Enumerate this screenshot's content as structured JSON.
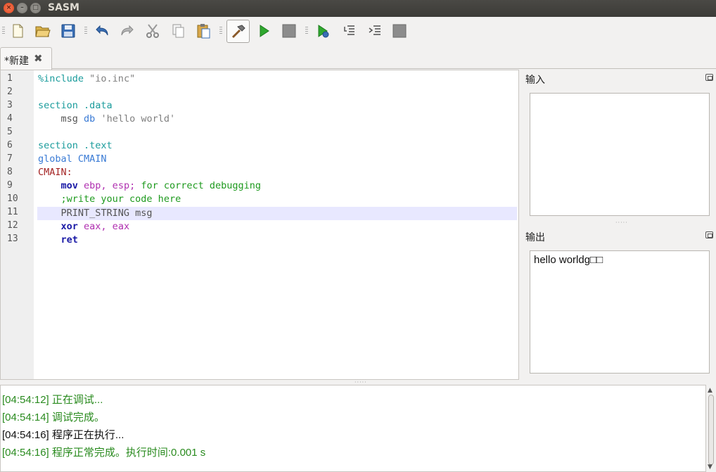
{
  "window": {
    "title": "SASM",
    "close_glyph": "×",
    "min_glyph": "–",
    "max_glyph": "□"
  },
  "toolbar": {
    "icons": [
      "new-file-icon",
      "open-folder-icon",
      "save-icon",
      "undo-icon",
      "redo-icon",
      "cut-icon",
      "copy-icon",
      "paste-icon",
      "build-hammer-icon",
      "run-icon",
      "stop-icon",
      "debug-icon",
      "step-into-icon",
      "step-over-icon",
      "stop-debug-icon"
    ]
  },
  "tabs": [
    {
      "label": "*新建",
      "close_glyph": "✖"
    }
  ],
  "editor": {
    "line_numbers": [
      "1",
      "2",
      "3",
      "4",
      "5",
      "6",
      "7",
      "8",
      "9",
      "10",
      "11",
      "12",
      "13"
    ],
    "highlighted_line": 11
  },
  "right_panel": {
    "input_title": "输入",
    "output_title": "输出",
    "output_text": "hello worldg□□"
  },
  "log": {
    "lines": [
      {
        "text": "[04:54:12] 正在调试...",
        "color": "#2a8b1f"
      },
      {
        "text": "[04:54:14] 调试完成。",
        "color": "#2a8b1f"
      },
      {
        "text": "[04:54:16] 程序正在执行...",
        "color": "#111111"
      },
      {
        "text": "[04:54:16] 程序正常完成。执行时间:0.001 s",
        "color": "#2a8b1f"
      }
    ]
  },
  "colors": {
    "accent_green": "#2a8b1f",
    "titlebar": "#3c3b37",
    "highlight_line": "#e8e8ff"
  }
}
